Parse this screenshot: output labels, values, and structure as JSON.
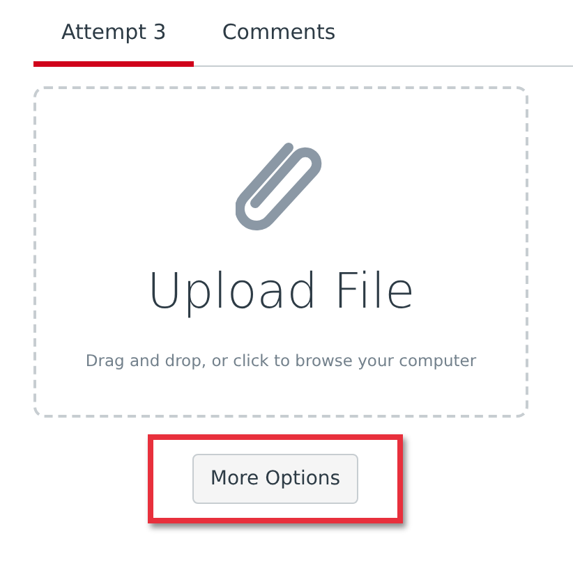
{
  "tabs": [
    {
      "label": "Attempt 3",
      "selected": true
    },
    {
      "label": "Comments",
      "selected": false
    }
  ],
  "upload": {
    "title": "Upload File",
    "hint": "Drag and drop, or click to browse your computer"
  },
  "more_options_button": {
    "label": "More Options",
    "highlighted": true
  }
}
